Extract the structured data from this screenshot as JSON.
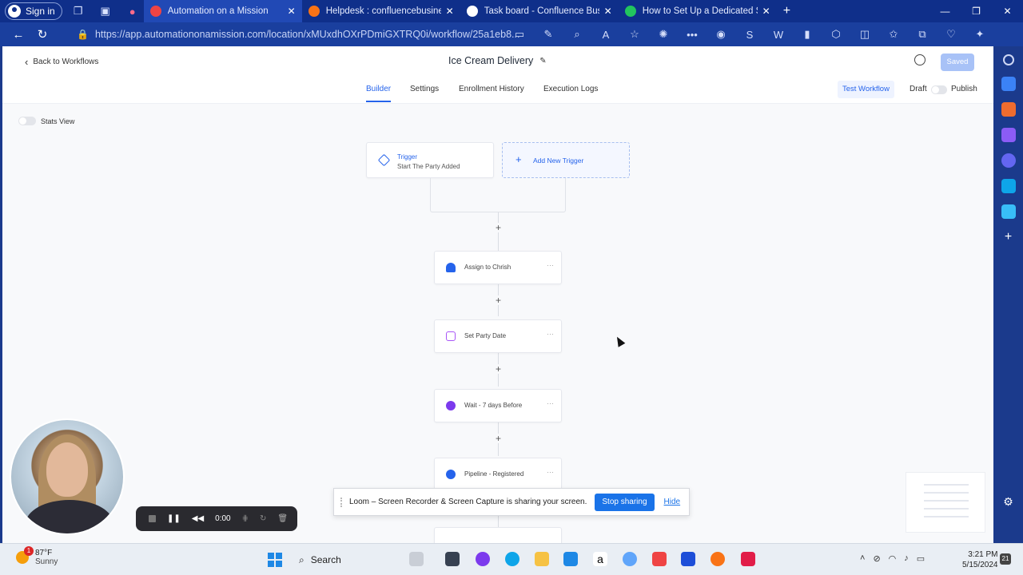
{
  "browser": {
    "signin_label": "Sign in",
    "tabs": [
      {
        "title": "Automation on a Mission",
        "active": true,
        "favicon_color": "#ef4444"
      },
      {
        "title": "Helpdesk : confluencebusinesss",
        "active": false,
        "favicon_color": "#f97316"
      },
      {
        "title": "Task board - Confluence Busine",
        "active": false,
        "favicon_color": "#ffffff"
      },
      {
        "title": "How to Set Up a Dedicated Send",
        "active": false,
        "favicon_color": "#22c55e"
      }
    ],
    "url": "https://app.automationonamission.com/location/xMUxdhOXrPDmiGXTRQ0i/workflow/25a1eb8..."
  },
  "app": {
    "back_label": "Back to Workflows",
    "workflow_title": "Ice Cream Delivery",
    "saved_label": "Saved",
    "tabs": [
      "Builder",
      "Settings",
      "Enrollment History",
      "Execution Logs"
    ],
    "active_tab": "Builder",
    "test_workflow_label": "Test Workflow",
    "draft_label": "Draft",
    "publish_label": "Publish",
    "stats_view_label": "Stats View"
  },
  "canvas": {
    "trigger": {
      "label": "Trigger",
      "sub": "Start The Party Added"
    },
    "add_trigger_label": "Add New Trigger",
    "actions": [
      {
        "label": "Assign to Chrish",
        "icon": "user-icon",
        "color": "#2563eb"
      },
      {
        "label": "Set Party Date",
        "icon": "calendar-icon",
        "color": "#a855f7"
      },
      {
        "label": "Wait - 7 days Before",
        "icon": "clock-icon",
        "color": "#7c3aed"
      },
      {
        "label": "Pipeline - Registered",
        "icon": "pipeline-icon",
        "color": "#2563eb"
      }
    ]
  },
  "loom": {
    "message": "Loom – Screen Recorder & Screen Capture is sharing your screen.",
    "stop_label": "Stop sharing",
    "hide_label": "Hide",
    "timer": "0:00"
  },
  "taskbar": {
    "weather_temp": "87°F",
    "weather_desc": "Sunny",
    "weather_badge": "1",
    "search_label": "Search",
    "time": "3:21 PM",
    "date": "5/15/2024",
    "notification_count": "21"
  }
}
